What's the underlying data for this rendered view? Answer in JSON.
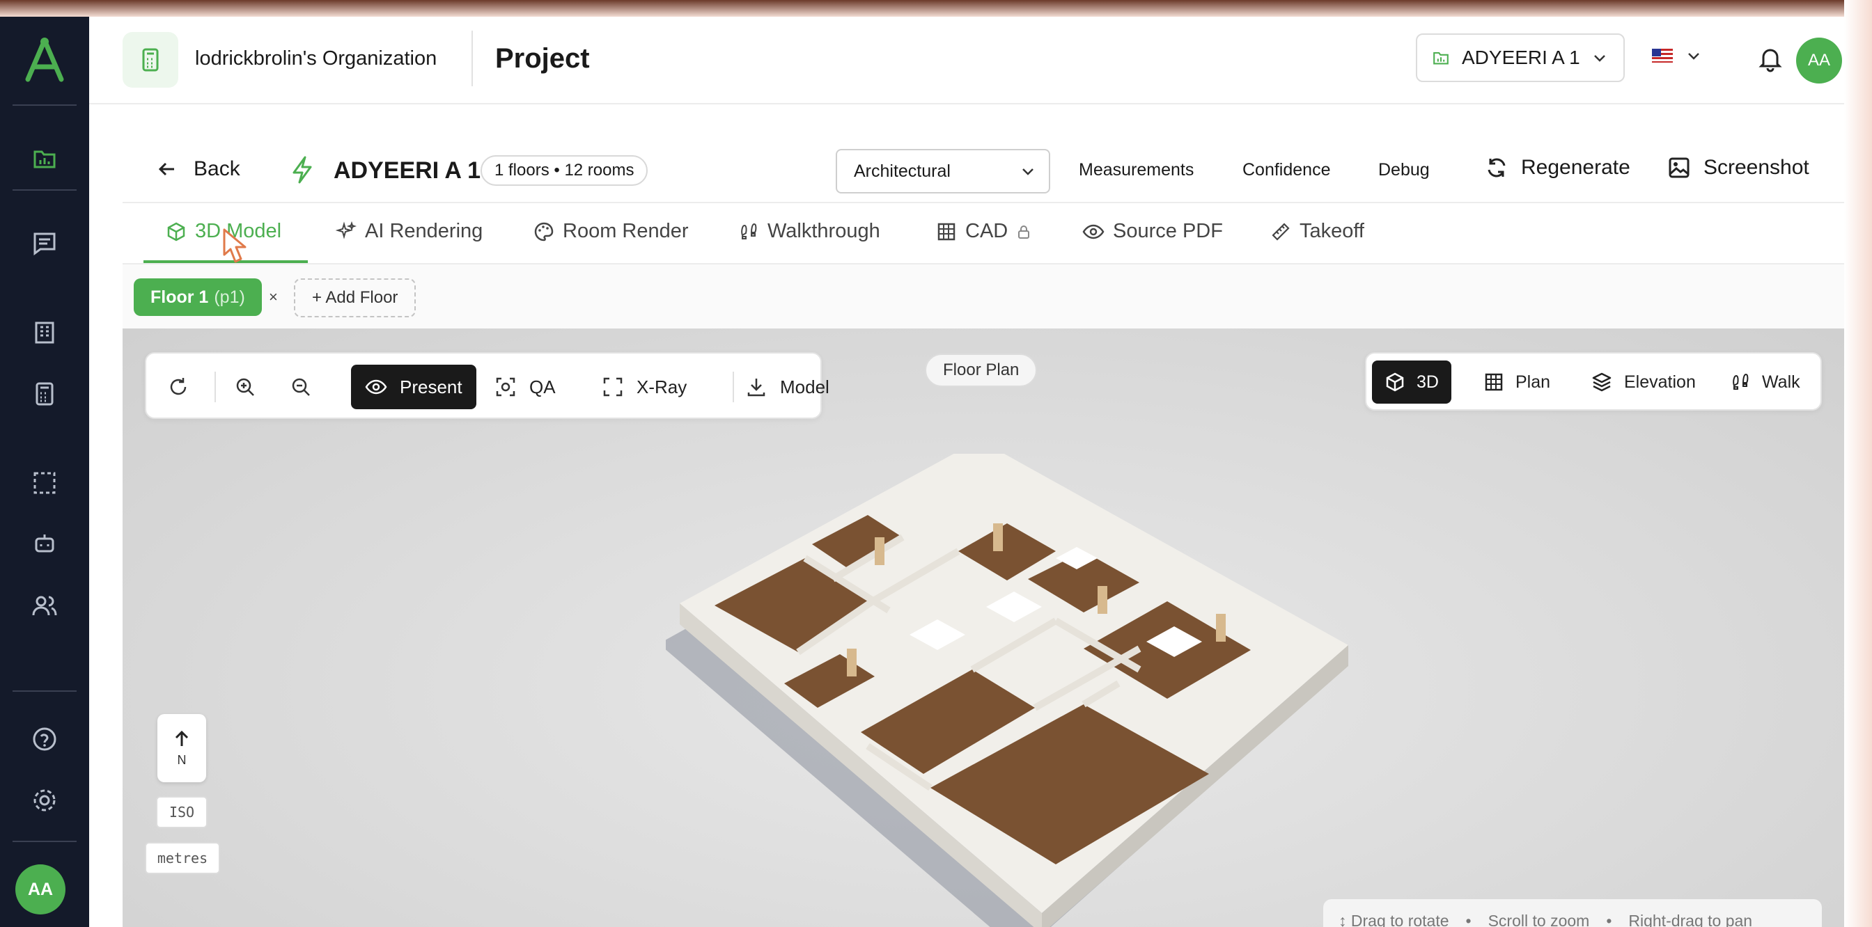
{
  "colors": {
    "accent": "#4caf50",
    "sidebar_bg": "#141a2a",
    "dark_button": "#1a1a1a"
  },
  "sidebar": {
    "items": [
      {
        "icon": "project-icon"
      },
      {
        "icon": "chat-icon"
      },
      {
        "icon": "building-icon"
      },
      {
        "icon": "calculator-icon"
      },
      {
        "icon": "selection-icon"
      },
      {
        "icon": "robot-icon"
      },
      {
        "icon": "users-icon"
      },
      {
        "icon": "help-icon"
      },
      {
        "icon": "gear-icon"
      }
    ],
    "avatar": "AA"
  },
  "header": {
    "org_name": "lodrickbrolin's Organization",
    "title": "Project",
    "project_select": "ADYEERI A 1",
    "avatar": "AA"
  },
  "toolbar": {
    "back": "Back",
    "model_title": "ADYEERI A 1",
    "floors_rooms": "1 floors • 12 rooms",
    "discipline": "Architectural",
    "links": [
      "Measurements",
      "Confidence",
      "Debug"
    ],
    "regenerate": "Regenerate",
    "screenshot": "Screenshot"
  },
  "tabs": [
    "3D Model",
    "AI Rendering",
    "Room Render",
    "Walkthrough",
    "CAD",
    "Source PDF",
    "Takeoff"
  ],
  "floor_row": {
    "floor_label": "Floor 1",
    "floor_sub": "(p1)",
    "close": "×",
    "add_floor": "+ Add Floor"
  },
  "viewport": {
    "present": "Present",
    "qa": "QA",
    "xray": "X-Ray",
    "model": "Model",
    "floor_plan": "Floor Plan",
    "modes": [
      "3D",
      "Plan",
      "Elevation",
      "Walk"
    ],
    "compass": "N",
    "iso": "ISO",
    "units": "metres",
    "hints": [
      "↕ Drag to rotate",
      "•",
      "Scroll to zoom",
      "•",
      "Right-drag to pan"
    ]
  }
}
